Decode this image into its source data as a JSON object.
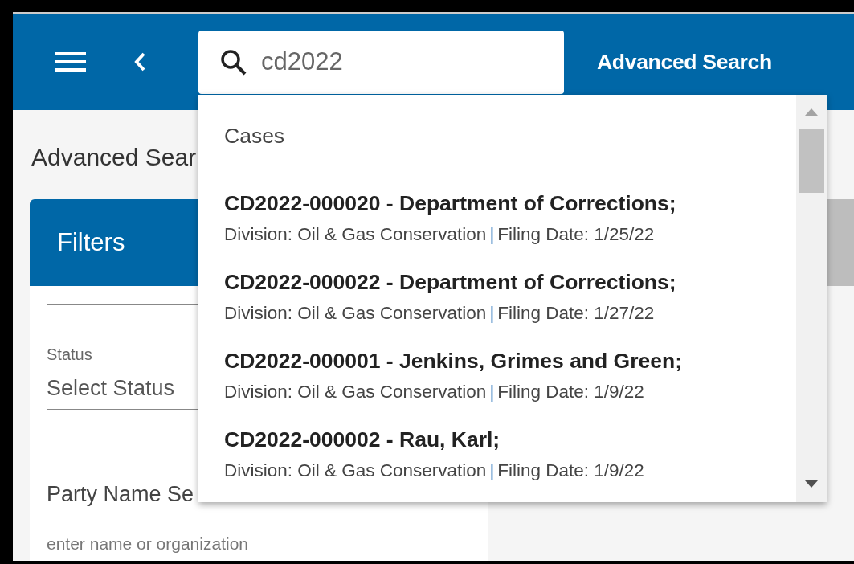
{
  "header": {
    "search": {
      "value": "cd2022"
    },
    "title": "Advanced Search"
  },
  "page_title": "Advanced Sear",
  "filters": {
    "title": "Filters",
    "status": {
      "label": "Status",
      "placeholder": "Select Status"
    },
    "party_name": {
      "placeholder": "Party Name Se",
      "hint": "enter name or organization"
    }
  },
  "dropdown": {
    "section": "Cases",
    "results": [
      {
        "title": "CD2022-000020 - Department of Corrections;",
        "division": "Division: Oil & Gas Conservation",
        "separator": "|",
        "filing": "Filing Date: 1/25/22"
      },
      {
        "title": "CD2022-000022 - Department of Corrections;",
        "division": "Division: Oil & Gas Conservation",
        "separator": "|",
        "filing": "Filing Date: 1/27/22"
      },
      {
        "title": "CD2022-000001 - Jenkins, Grimes and Green;",
        "division": "Division: Oil & Gas Conservation",
        "separator": "|",
        "filing": "Filing Date: 1/9/22"
      },
      {
        "title": "CD2022-000002 - Rau, Karl;",
        "division": "Division: Oil & Gas Conservation",
        "separator": "|",
        "filing": "Filing Date: 1/9/22"
      }
    ]
  }
}
